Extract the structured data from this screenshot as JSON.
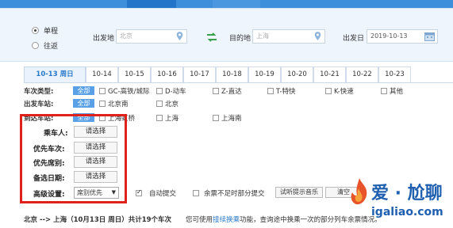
{
  "trip_type": {
    "single": "单程",
    "round": "往返"
  },
  "search": {
    "from_label": "出发地",
    "from_value": "北京",
    "to_label": "目的地",
    "to_value": "上海",
    "date_label": "出发日",
    "date_value": "2019-10-13"
  },
  "date_tabs": [
    "10-13 周日",
    "10-14",
    "10-15",
    "10-16",
    "10-17",
    "10-18",
    "10-19",
    "10-20",
    "10-21",
    "10-22",
    "10-23"
  ],
  "filters": {
    "train_type": {
      "label": "车次类型:",
      "all": "全部",
      "options": [
        "GC-高铁/城际",
        "D-动车",
        "Z-直达",
        "T-特快",
        "K-快速",
        "其他"
      ]
    },
    "depart_station": {
      "label": "出发车站:",
      "all": "全部",
      "options": [
        "北京南",
        "北京"
      ]
    },
    "arrive_station": {
      "label": "到达车站:",
      "all": "全部",
      "options": [
        "上海虹桥",
        "上海",
        "上海南"
      ]
    }
  },
  "advanced": {
    "passenger": {
      "label": "乘车人:",
      "button": "请选择"
    },
    "priority_train": {
      "label": "优先车次:",
      "button": "请选择"
    },
    "priority_seat": {
      "label": "优先席别:",
      "button": "请选择"
    },
    "alt_date": {
      "label": "备选日期:",
      "button": "请选择"
    },
    "settings": {
      "label": "高级设置:",
      "select_value": "席别优先"
    },
    "auto_submit": "自动提交",
    "partial_submit": "余票不足时部分提交",
    "test_music": "试听提示音乐",
    "clear_selection": "清空"
  },
  "summary": {
    "route": "北京 --> 上海（10月13日 周日）共计19个车次",
    "hint_prefix": "您可使用",
    "hint_link": "接续换乘",
    "hint_suffix": "功能，查询途中换乘一次的部分列车余票情况。"
  },
  "watermark": {
    "line1": "爱 · 尬聊",
    "line2": "igaliao.com"
  },
  "colors": {
    "accent": "#3d8edb",
    "highlight_box": "#e0201b",
    "tab_active": "#2778c9"
  }
}
